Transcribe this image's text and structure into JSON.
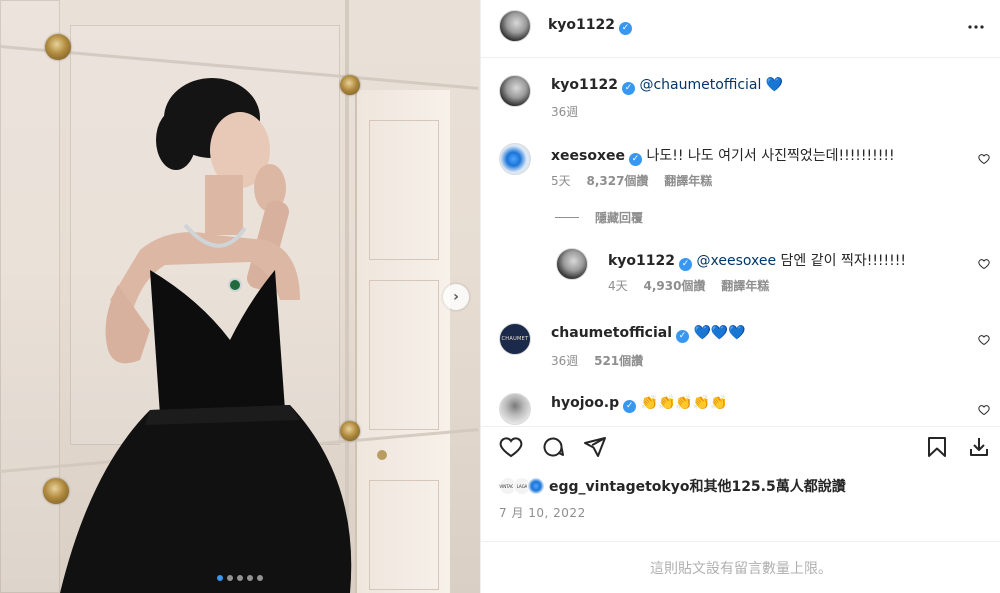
{
  "post": {
    "author": "kyo1122",
    "caption_mention": "@chaumetofficial",
    "caption_emoji": "💙",
    "caption_time": "36週",
    "more_icon": "more-horizontal-icon"
  },
  "carousel": {
    "slide_count": 5,
    "active_index": 0,
    "next_icon": "chevron-right-icon"
  },
  "comments": [
    {
      "username": "xeesoxee",
      "text": "나도!! 나도 여기서 사진찍었는데!!!!!!!!!!",
      "time": "5天",
      "likes": "8,327個讚",
      "translate": "翻譯年糕"
    },
    {
      "username": "kyo1122",
      "mention": "@xeesoxee",
      "text": " 담엔 같이 찍자!!!!!!!",
      "time": "4天",
      "likes": "4,930個讚",
      "translate": "翻譯年糕"
    },
    {
      "username": "chaumetofficial",
      "text": "💙💙💙",
      "time": "36週",
      "likes": "521個讚"
    },
    {
      "username": "hyojoo.p",
      "text": "👏👏👏👏👏"
    }
  ],
  "hide_replies": "隱藏回覆",
  "chaumet_avatar_text": "CHAUMET",
  "mini_avatar_text": [
    "VINTAGE",
    "LAGA"
  ],
  "likes_summary": "egg_vintagetokyo和其他125.5萬人都說讚",
  "post_date": "7 月 10, 2022",
  "comments_limited": "這則貼文設有留言數量上限。",
  "icons": {
    "like": "heart-icon",
    "comment": "comment-icon",
    "share": "share-icon",
    "save": "bookmark-icon",
    "download": "download-icon"
  },
  "colors": {
    "verified": "#3897f0",
    "link": "#00376b",
    "muted": "#8e8e8e"
  }
}
